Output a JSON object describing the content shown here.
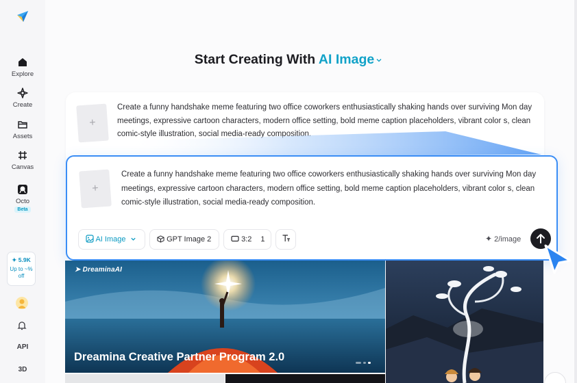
{
  "sidebar": {
    "items": [
      {
        "label": "Explore",
        "icon": "home-icon"
      },
      {
        "label": "Create",
        "icon": "sparkle-icon"
      },
      {
        "label": "Assets",
        "icon": "folder-icon"
      },
      {
        "label": "Canvas",
        "icon": "canvas-icon"
      },
      {
        "label": "Octo",
        "icon": "octo-icon"
      }
    ],
    "beta_label": "Beta",
    "promo": {
      "count": "5.9K",
      "offer": "Up to ~% off"
    },
    "api_label": "API",
    "three_d_label": "3D"
  },
  "heading": {
    "prefix": "Start Creating With",
    "accent": "AI Image"
  },
  "prompt_back": "Create a funny handshake meme featuring two office coworkers enthusiastically shaking hands over surviving Mon day meetings, expressive cartoon characters, modern office setting, bold meme caption placeholders, vibrant color s, clean comic-style illustration, social media-ready composition.",
  "prompt_front": "Create a funny handshake meme featuring two office coworkers enthusiastically shaking hands over surviving Mon day meetings, expressive cartoon characters, modern office setting, bold meme caption placeholders, vibrant color s, clean comic-style illustration, social media-ready composition.",
  "toolbar": {
    "mode": "AI Image",
    "model": "GPT Image 2",
    "ratio": "3:2",
    "count": "1",
    "cost": "2/image"
  },
  "banner": {
    "brand": "DreaminaAI",
    "title": "Dreamina Creative Partner Program 2.0"
  },
  "colors": {
    "accent": "#11a2c8",
    "focus_border": "#3a8df5"
  }
}
